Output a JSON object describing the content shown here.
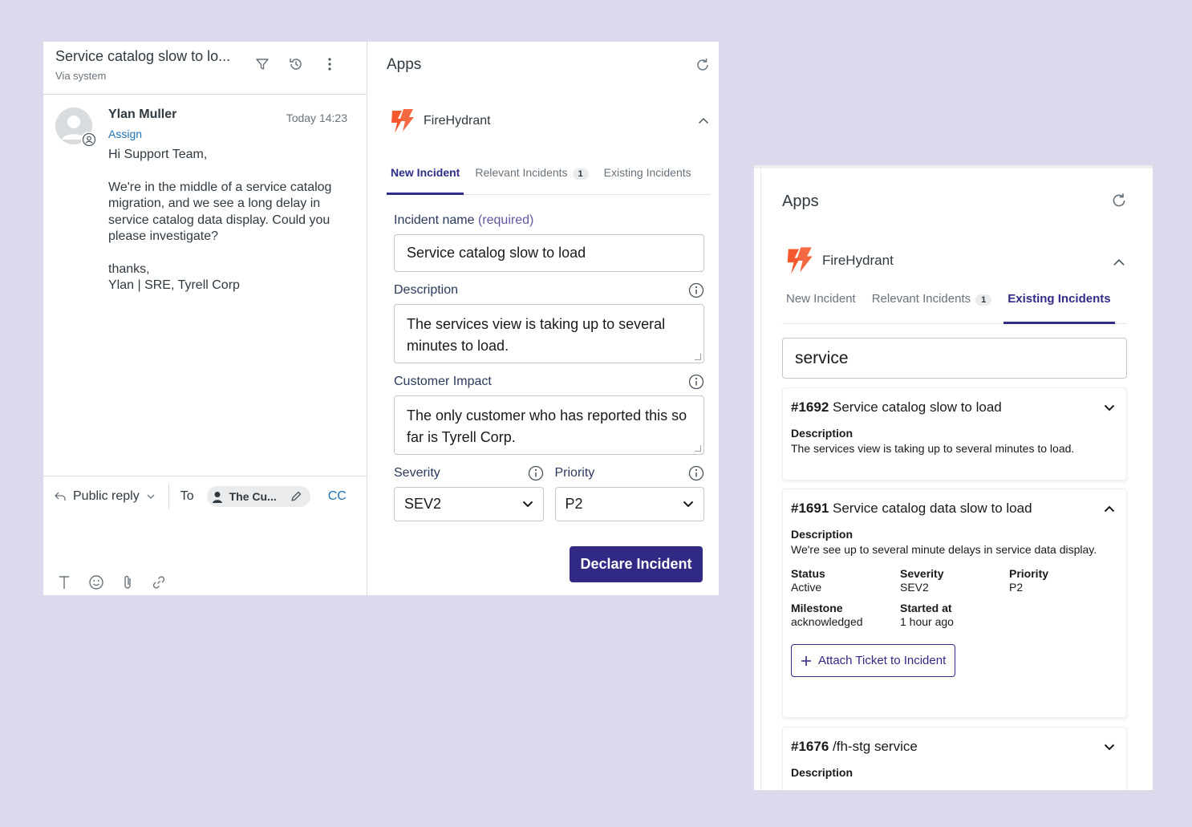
{
  "ticket": {
    "title": "Service catalog slow to lo...",
    "via": "Via system",
    "message": {
      "author": "Ylan Muller",
      "time": "Today 14:23",
      "assign": "Assign",
      "body": "Hi Support Team,\n\nWe're in the middle of a service catalog migration, and we see a long delay in service catalog data display.  Could you please investigate?\n\nthanks,\nYlan | SRE, Tyrell Corp"
    },
    "reply": {
      "type": "Public reply",
      "to_label": "To",
      "recipient": "The Cu...",
      "cc": "CC"
    },
    "icons": [
      "filter-icon",
      "history-icon",
      "more-vertical-icon",
      "reply-arrow-icon",
      "text-format-icon",
      "emoji-icon",
      "attachment-icon",
      "link-icon"
    ]
  },
  "apps_panel": {
    "title": "Apps",
    "app_name": "FireHydrant",
    "tabs": [
      {
        "label": "New Incident",
        "active": true
      },
      {
        "label": "Relevant Incidents",
        "badge": "1"
      },
      {
        "label": "Existing Incidents"
      }
    ],
    "form": {
      "name_label": "Incident name",
      "name_required": "(required)",
      "name_value": "Service catalog slow to load",
      "description_label": "Description",
      "description_value": "The services view is taking up to several minutes to load.",
      "impact_label": "Customer Impact",
      "impact_value": "The only customer who has reported this so far is Tyrell Corp.",
      "severity_label": "Severity",
      "severity_value": "SEV2",
      "priority_label": "Priority",
      "priority_value": "P2",
      "submit_label": "Declare Incident"
    }
  },
  "existing_panel": {
    "title": "Apps",
    "app_name": "FireHydrant",
    "tabs": [
      {
        "label": "New Incident"
      },
      {
        "label": "Relevant Incidents",
        "badge": "1"
      },
      {
        "label": "Existing Incidents",
        "active": true
      }
    ],
    "search_value": "service",
    "incidents": [
      {
        "number": "#1692",
        "title": "Service catalog slow to load",
        "description_label": "Description",
        "description": "The services view is taking up to several minutes to load.",
        "expanded": false
      },
      {
        "number": "#1691",
        "title": "Service catalog data slow to load",
        "description_label": "Description",
        "description": "We're see up to several minute delays in service data display.",
        "expanded": true,
        "status_label": "Status",
        "status": "Active",
        "severity_label": "Severity",
        "severity": "SEV2",
        "priority_label": "Priority",
        "priority": "P2",
        "milestone_label": "Milestone",
        "milestone": "acknowledged",
        "started_label": "Started at",
        "started": "1 hour ago",
        "attach_label": "Attach Ticket to Incident"
      },
      {
        "number": "#1676",
        "title": "/fh-stg service",
        "description_label": "Description",
        "expanded": false
      }
    ]
  },
  "colors": {
    "background": "#ddd8ec",
    "accent": "#302a85",
    "link": "#1f73b7",
    "brand": "#f4592e"
  }
}
